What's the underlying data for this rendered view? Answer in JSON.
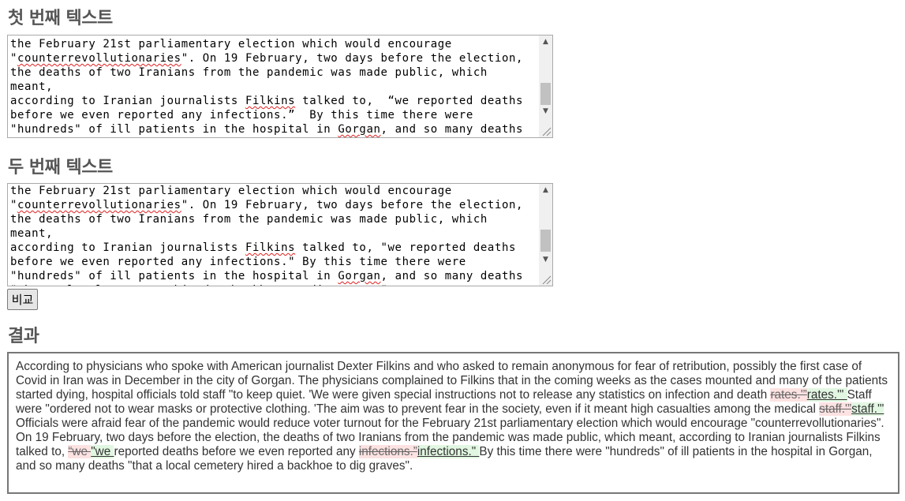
{
  "labels": {
    "first_text": "첫 번째 텍스트",
    "second_text": "두 번째 텍스트",
    "compare_button": "비교",
    "result": "결과"
  },
  "textarea1": {
    "lines": [
      [
        "the February 21st parliamentary election which would encourage"
      ],
      [
        "\"",
        {
          "sq": "counterrevollutionaries"
        },
        "\". On 19 February, two days before the election,"
      ],
      [
        "the deaths of two Iranians from the pandemic was made public, which meant,"
      ],
      [
        "according to Iranian journalists ",
        {
          "sq": "Filkins"
        },
        " talked to,  “we reported deaths"
      ],
      [
        "before we even reported any infections.”  By this time there were"
      ],
      [
        "\"hundreds\" of ill patients in the hospital in ",
        {
          "sq": "Gorgan"
        },
        ", and so many deaths"
      ],
      [
        "\"that a local cemetery hired a backhoe to dig graves\"."
      ]
    ]
  },
  "textarea2": {
    "lines": [
      [
        "the February 21st parliamentary election which would encourage"
      ],
      [
        "\"",
        {
          "sq": "counterrevollutionaries"
        },
        "\". On 19 February, two days before the election,"
      ],
      [
        "the deaths of two Iranians from the pandemic was made public, which meant,"
      ],
      [
        "according to Iranian journalists ",
        {
          "sq": "Filkins"
        },
        " talked to, \"we reported deaths"
      ],
      [
        "before we even reported any infections.\" By this time there were"
      ],
      [
        "\"hundreds\" of ill patients in the hospital in ",
        {
          "sq": "Gorgan"
        },
        ", and so many deaths"
      ],
      [
        "\"that a local cemetery hired a backhoe to dig graves\"."
      ]
    ]
  },
  "result_segments": [
    {
      "t": "text",
      "v": "According to physicians who spoke with American journalist Dexter Filkins and who asked to remain anonymous for fear of retribution, possibly the first case of Covid in Iran was in December in the city of Gorgan. The physicians complained to Filkins that in the coming weeks as the cases mounted and many of the patients started dying, hospital officials told staff \"to keep quiet. 'We were given special instructions not to release any statistics on infection and death "
    },
    {
      "t": "del",
      "v": "rates.'”"
    },
    {
      "t": "ins",
      "v": "rates.'\" "
    },
    {
      "t": "text",
      "v": "Staff were \"ordered not to wear masks or protective clothing. 'The aim was to prevent fear in the society, even if it meant high casualties among the medical "
    },
    {
      "t": "del",
      "v": "staff.'”"
    },
    {
      "t": "ins",
      "v": "staff.'\" "
    },
    {
      "t": "text",
      "v": "Officials were afraid fear of the pandemic would reduce voter turnout for the February 21st parliamentary election which would encourage \"counterrevollutionaries\". On 19 February, two days before the election, the deaths of two Iranians from the pandemic was made public, which meant, according to Iranian journalists Filkins talked to, "
    },
    {
      "t": "del",
      "v": "“we "
    },
    {
      "t": "ins",
      "v": "\"we "
    },
    {
      "t": "text",
      "v": "reported deaths before we even reported any "
    },
    {
      "t": "del",
      "v": "infections.”"
    },
    {
      "t": "ins",
      "v": "infections.\" "
    },
    {
      "t": "text",
      "v": "By this time there were \"hundreds\" of ill patients in the hospital in Gorgan, and so many deaths \"that a local cemetery hired a backhoe to dig graves\"."
    }
  ]
}
